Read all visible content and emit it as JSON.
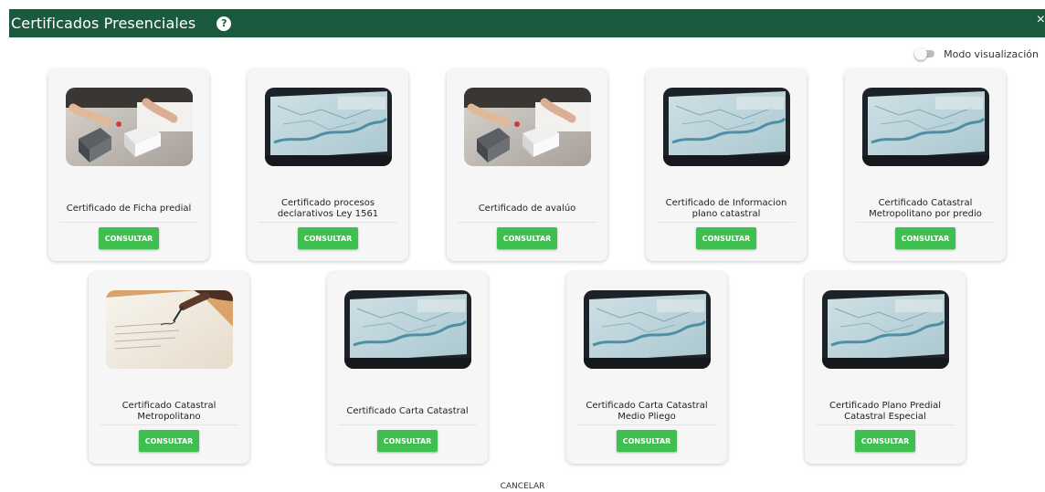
{
  "dialog": {
    "title": "Certificados Presenciales",
    "help_icon": "question-circle-icon",
    "close_icon": "close-icon",
    "close_glyph": "×",
    "help_glyph": "?"
  },
  "toggle": {
    "label": "Modo visualización",
    "checked": false
  },
  "cards": [
    {
      "caption": "Certificado de Ficha predial",
      "button": "CONSULTAR",
      "image": "hands-with-house-models"
    },
    {
      "caption": "Certificado procesos declarativos Ley 1561",
      "button": "CONSULTAR",
      "image": "map-screen"
    },
    {
      "caption": "Certificado de avalúo",
      "button": "CONSULTAR",
      "image": "hands-with-house-models"
    },
    {
      "caption": "Certificado de Informacion plano catastral",
      "button": "CONSULTAR",
      "image": "map-screen"
    },
    {
      "caption": "Certificado Catastral Metropolitano por predio",
      "button": "CONSULTAR",
      "image": "map-screen"
    },
    {
      "caption": "Certificado Catastral Metropolitano",
      "button": "CONSULTAR",
      "image": "hand-signing-document"
    },
    {
      "caption": "Certificado Carta Catastral",
      "button": "CONSULTAR",
      "image": "map-screen"
    },
    {
      "caption": "Certificado Carta Catastral Medio Pliego",
      "button": "CONSULTAR",
      "image": "map-screen"
    },
    {
      "caption": "Certificado Plano Predial Catastral Especial",
      "button": "CONSULTAR",
      "image": "map-screen"
    }
  ],
  "footer": {
    "cancel_label": "CANCELAR"
  },
  "colors": {
    "header": "#1b5a3e",
    "button": "#3fbf50",
    "card": "#f6f6f6"
  }
}
